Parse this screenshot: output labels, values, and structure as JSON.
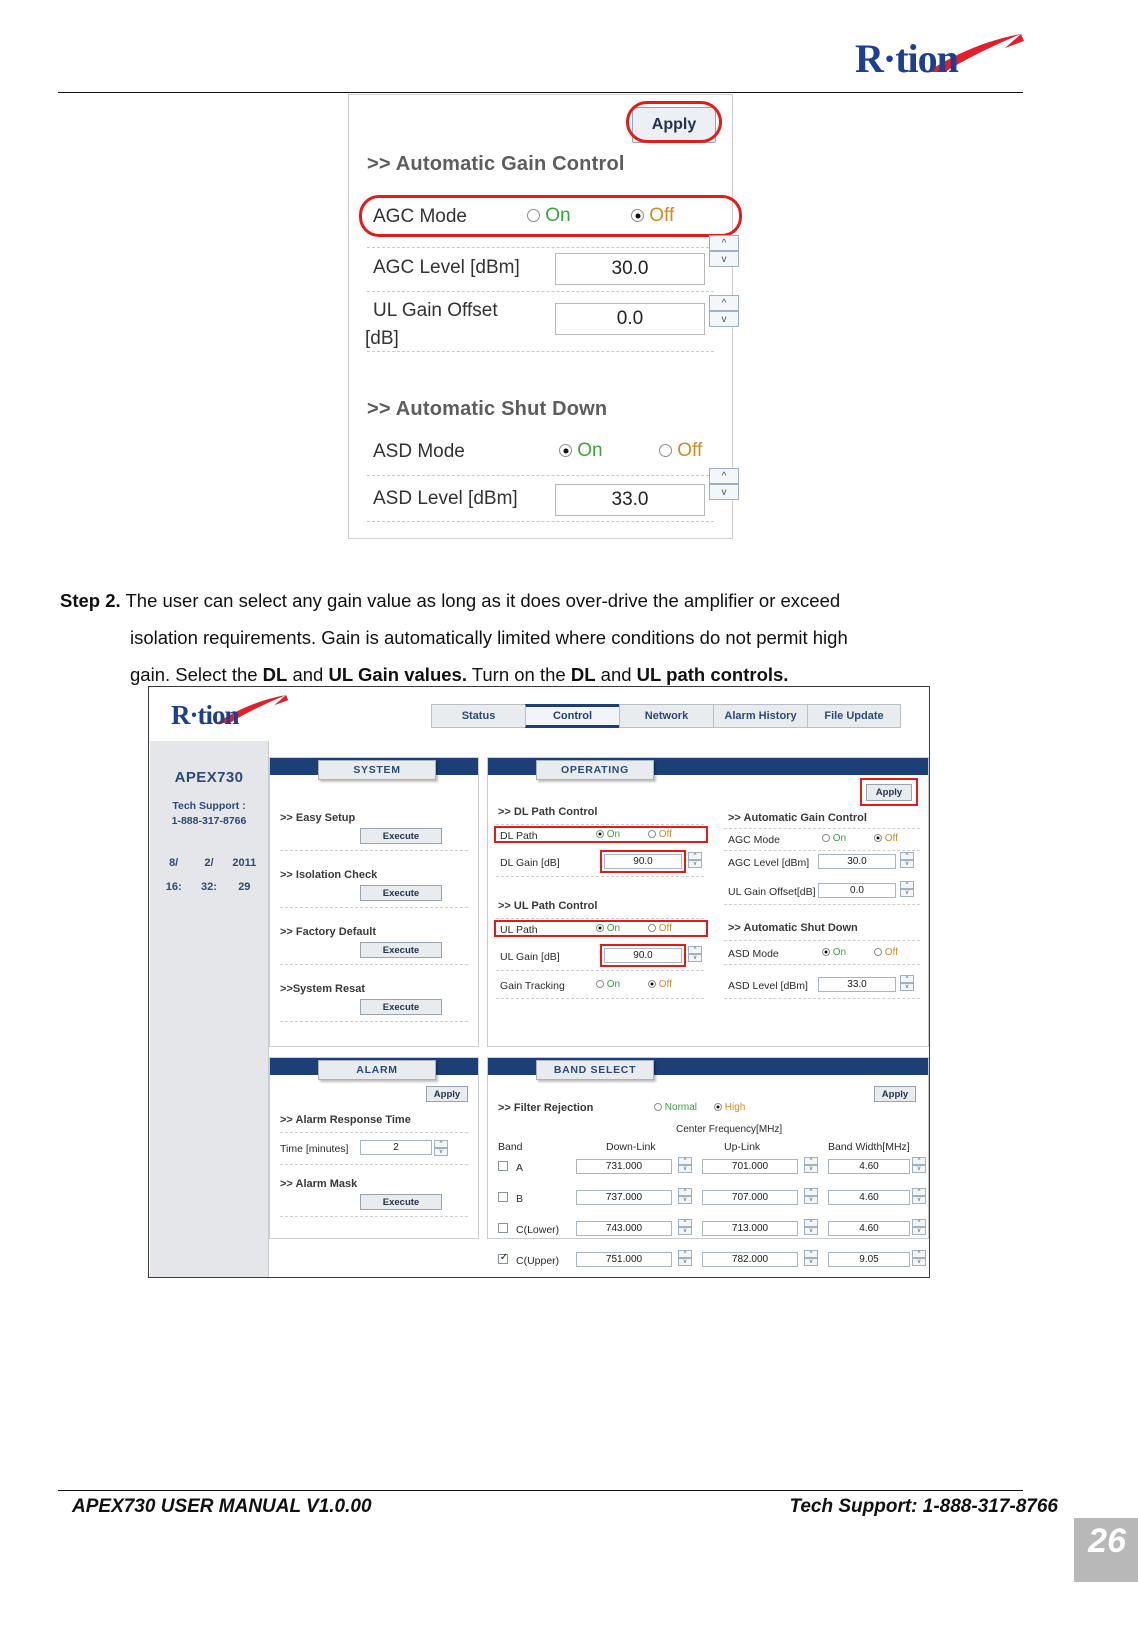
{
  "header": {
    "logo_text": "R·tion"
  },
  "figure_agc": {
    "apply_label": "Apply",
    "section1": ">> Automatic Gain Control",
    "agc_mode_label": "AGC Mode",
    "on_label": "On",
    "off_label": "Off",
    "agc_mode_value": "Off",
    "agc_level_label": "AGC Level [dBm]",
    "agc_level_value": "30.0",
    "ul_gain_offset_label_1": "UL Gain Offset",
    "ul_gain_offset_label_2": "[dB]",
    "ul_gain_offset_value": "0.0",
    "section2": ">> Automatic Shut Down",
    "asd_mode_label": "ASD Mode",
    "asd_mode_value": "On",
    "asd_level_label": "ASD Level [dBm]",
    "asd_level_value": "33.0",
    "spin_up": "^",
    "spin_down": "v"
  },
  "step": {
    "label": "Step 2.",
    "line1": "The user can select any gain value as long as it does over-drive the amplifier or exceed",
    "line2": "isolation requirements. Gain is automatically limited where conditions do not permit high",
    "line3_a": "gain. Select the ",
    "line3_b1": "DL",
    "line3_c": " and ",
    "line3_b2": "UL Gain values.",
    "line3_d": " Turn on the ",
    "line3_b3": "DL",
    "line3_e": " and ",
    "line3_b4": "UL path controls."
  },
  "webui": {
    "logo_text": "R·tion",
    "tabs": [
      {
        "label": "Status",
        "selected": false
      },
      {
        "label": "Control",
        "selected": true
      },
      {
        "label": "Network",
        "selected": false
      },
      {
        "label": "Alarm History",
        "selected": false
      },
      {
        "label": "File Update",
        "selected": false
      }
    ],
    "sidebar": {
      "model": "APEX730",
      "tech_support_label": "Tech Support :",
      "tech_support_phone": "1-888-317-8766",
      "date": [
        "8/",
        "2/",
        "2011"
      ],
      "time": [
        "16:",
        "32:",
        "29"
      ]
    },
    "system_panel": {
      "tab": "SYSTEM",
      "items": [
        {
          "label": ">> Easy Setup",
          "button": "Execute"
        },
        {
          "label": ">> Isolation Check",
          "button": "Execute"
        },
        {
          "label": ">> Factory Default",
          "button": "Execute"
        },
        {
          "label": ">>System Resat",
          "button": "Execute"
        }
      ]
    },
    "alarm_panel": {
      "tab": "ALARM",
      "apply_label": "Apply",
      "response_time_section": ">> Alarm Response Time",
      "time_label": "Time [minutes]",
      "time_value": "2",
      "mask_section": ">> Alarm Mask",
      "mask_button": "Execute"
    },
    "operating_panel": {
      "tab": "OPERATING",
      "dl_section": ">> DL Path Control",
      "dl_path_label": "DL Path",
      "dl_path_value": "On",
      "dl_gain_label": "DL Gain [dB]",
      "dl_gain_value": "90.0",
      "ul_section": ">> UL Path Control",
      "ul_path_label": "UL Path",
      "ul_path_value": "On",
      "ul_gain_label": "UL Gain [dB]",
      "ul_gain_value": "90.0",
      "gain_tracking_label": "Gain Tracking",
      "gain_tracking_value": "Off",
      "on_label": "On",
      "off_label": "Off"
    },
    "agc_panel": {
      "apply_label": "Apply",
      "agc_section": ">> Automatic Gain Control",
      "agc_mode_label": "AGC Mode",
      "agc_mode_value": "Off",
      "agc_level_label": "AGC Level [dBm]",
      "agc_level_value": "30.0",
      "ul_offset_label": "UL Gain Offset[dB]",
      "ul_offset_value": "0.0",
      "asd_section": ">> Automatic Shut Down",
      "asd_mode_label": "ASD Mode",
      "asd_mode_value": "On",
      "asd_level_label": "ASD Level [dBm]",
      "asd_level_value": "33.0",
      "on_label": "On",
      "off_label": "Off"
    },
    "band_panel": {
      "tab": "BAND SELECT",
      "apply_label": "Apply",
      "filter_rejection_label": ">> Filter Rejection",
      "normal_label": "Normal",
      "high_label": "High",
      "filter_rejection_value": "High",
      "center_freq_header": "Center Frequency[MHz]",
      "col_band": "Band",
      "col_downlink": "Down-Link",
      "col_uplink": "Up-Link",
      "col_bandwidth": "Band Width[MHz]",
      "rows": [
        {
          "band": "A",
          "checked": false,
          "downlink": "731.000",
          "uplink": "701.000",
          "bandwidth": "4.60"
        },
        {
          "band": "B",
          "checked": false,
          "downlink": "737.000",
          "uplink": "707.000",
          "bandwidth": "4.60"
        },
        {
          "band": "C(Lower)",
          "checked": false,
          "downlink": "743.000",
          "uplink": "713.000",
          "bandwidth": "4.60"
        },
        {
          "band": "C(Upper)",
          "checked": true,
          "downlink": "751.000",
          "uplink": "782.000",
          "bandwidth": "9.05"
        }
      ]
    },
    "spin_up": "^",
    "spin_down": "v"
  },
  "footer": {
    "left": "APEX730 USER MANUAL V1.0.00",
    "right": "Tech Support: 1-888-317-8766",
    "page": "26"
  },
  "colors": {
    "brand_blue": "#1d3f8f",
    "panel_blue": "#1c3f78",
    "highlight_red": "#e31b1b",
    "on_green": "#36a83c",
    "off_orange": "#cf8b28"
  }
}
